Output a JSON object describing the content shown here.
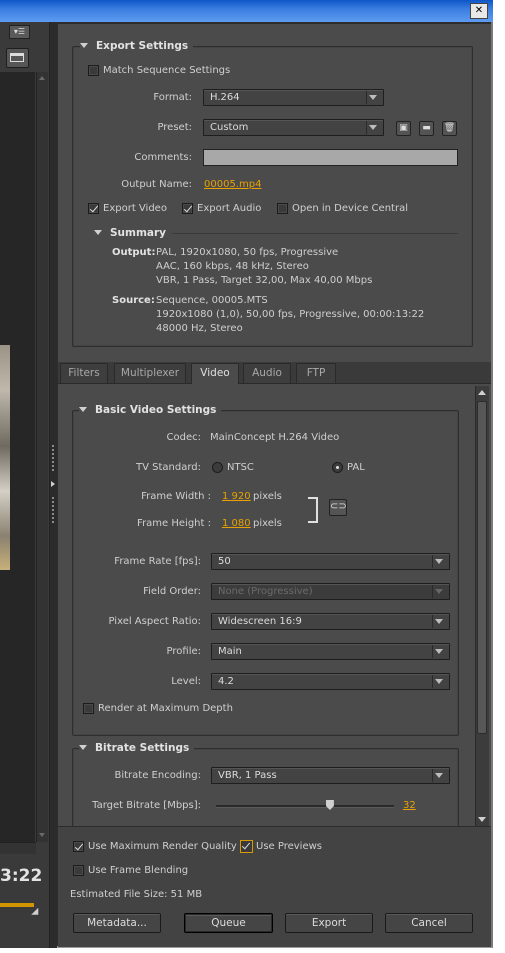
{
  "window": {
    "close_label": "✕"
  },
  "export_settings": {
    "header": "Export Settings",
    "match_sequence": "Match Sequence Settings",
    "format_label": "Format:",
    "format_value": "H.264",
    "preset_label": "Preset:",
    "preset_value": "Custom",
    "comments_label": "Comments:",
    "comments_value": "",
    "output_name_label": "Output Name:",
    "output_name_value": "00005.mp4",
    "export_video": "Export Video",
    "export_audio": "Export Audio",
    "open_device_central": "Open in Device Central"
  },
  "summary": {
    "header": "Summary",
    "output_label": "Output:",
    "output_lines": [
      "PAL, 1920x1080, 50 fps, Progressive",
      "AAC, 160 kbps, 48 kHz, Stereo",
      "VBR, 1 Pass, Target 32,00, Max 40,00 Mbps"
    ],
    "source_label": "Source:",
    "source_lines": [
      "Sequence, 00005.MTS",
      "1920x1080 (1,0), 50,00 fps, Progressive, 00:00:13:22",
      "48000 Hz, Stereo"
    ]
  },
  "tabs": [
    "Filters",
    "Multiplexer",
    "Video",
    "Audio",
    "FTP"
  ],
  "basic_video": {
    "header": "Basic Video Settings",
    "codec_label": "Codec:",
    "codec_value": "MainConcept H.264 Video",
    "tv_standard_label": "TV Standard:",
    "ntsc": "NTSC",
    "pal": "PAL",
    "frame_width_label": "Frame Width :",
    "frame_width_value": "1 920",
    "frame_height_label": "Frame Height :",
    "frame_height_value": "1 080",
    "pixels": "pixels",
    "frame_rate_label": "Frame Rate [fps]:",
    "frame_rate_value": "50",
    "field_order_label": "Field Order:",
    "field_order_value": "None (Progressive)",
    "par_label": "Pixel Aspect Ratio:",
    "par_value": "Widescreen 16:9",
    "profile_label": "Profile:",
    "profile_value": "Main",
    "level_label": "Level:",
    "level_value": "4.2",
    "render_max_depth": "Render at Maximum Depth"
  },
  "bitrate": {
    "header": "Bitrate Settings",
    "encoding_label": "Bitrate Encoding:",
    "encoding_value": "VBR, 1 Pass",
    "target_label": "Target Bitrate [Mbps]:",
    "target_value": "32",
    "target_fraction": 0.64
  },
  "bottom": {
    "max_render_quality": "Use Maximum Render Quality",
    "use_previews": "Use Previews",
    "frame_blending": "Use Frame Blending",
    "file_size": "Estimated File Size:  51 MB",
    "metadata_btn": "Metadata...",
    "queue_btn": "Queue",
    "export_btn": "Export",
    "cancel_btn": "Cancel"
  },
  "left_panel": {
    "timecode": "3:22"
  },
  "colors": {
    "accent": "#e8a100",
    "panel": "#4b4b4b",
    "dark": "#2d2d2d"
  }
}
